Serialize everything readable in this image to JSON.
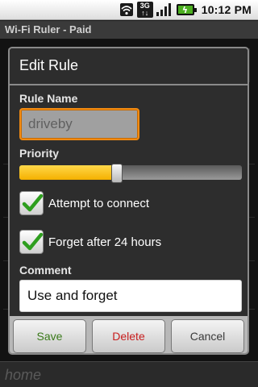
{
  "status_bar": {
    "time": "10:12 PM",
    "network_label_top": "3G",
    "network_label_bottom": "↑↓",
    "icons": [
      "wifi-icon",
      "signal-icon",
      "battery-icon"
    ]
  },
  "app": {
    "title": "Wi-Fi Ruler - Paid",
    "bottom_label": "home"
  },
  "dialog": {
    "title": "Edit Rule",
    "rule_name_label": "Rule Name",
    "rule_name_value": "driveby",
    "priority_label": "Priority",
    "priority_value": 0.44,
    "attempt_connect_label": "Attempt to connect",
    "attempt_connect_checked": true,
    "forget_label": "Forget after 24 hours",
    "forget_checked": true,
    "comment_label": "Comment",
    "comment_value": "Use and forget",
    "buttons": {
      "save": "Save",
      "delete": "Delete",
      "cancel": "Cancel"
    }
  },
  "colors": {
    "accent": "#f08a12",
    "slider_fill": "#f5b000",
    "check": "#2e9e1e",
    "save_text": "#3a7a1a",
    "delete_text": "#c81e1e"
  }
}
